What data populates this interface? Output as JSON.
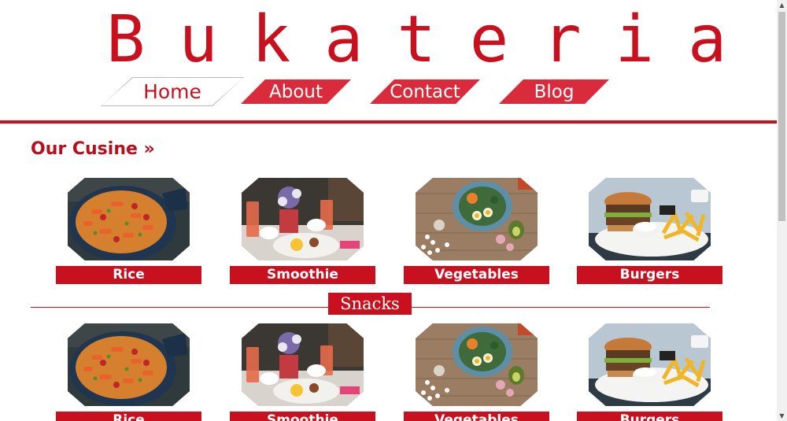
{
  "brand": {
    "logo": "Bukateria"
  },
  "nav": [
    {
      "label": "Home",
      "active": true
    },
    {
      "label": "About",
      "active": false
    },
    {
      "label": "Contact",
      "active": false
    },
    {
      "label": "Blog",
      "active": false
    }
  ],
  "section": {
    "title": "Our Cusine »"
  },
  "cuisine_cards": [
    {
      "caption": "Rice",
      "image": "jollof-rice-pan-image"
    },
    {
      "caption": "Smoothie",
      "image": "smoothie-breakfast-image"
    },
    {
      "caption": "Vegetables",
      "image": "vegetable-bowl-image"
    },
    {
      "caption": "Burgers",
      "image": "burger-fries-image"
    }
  ],
  "snacks": {
    "label": "Snacks",
    "cards": [
      {
        "caption": "Rice",
        "image": "jollof-rice-pan-image"
      },
      {
        "caption": "Smoothie",
        "image": "smoothie-breakfast-image"
      },
      {
        "caption": "Vegetables",
        "image": "vegetable-bowl-image"
      },
      {
        "caption": "Burgers",
        "image": "burger-fries-image"
      }
    ]
  },
  "colors": {
    "accent": "#c8101e",
    "nav_red": "#d92b3b"
  },
  "icons": {
    "scroll_up": "scroll-up-arrow-icon",
    "scroll_down": "scroll-down-arrow-icon"
  }
}
